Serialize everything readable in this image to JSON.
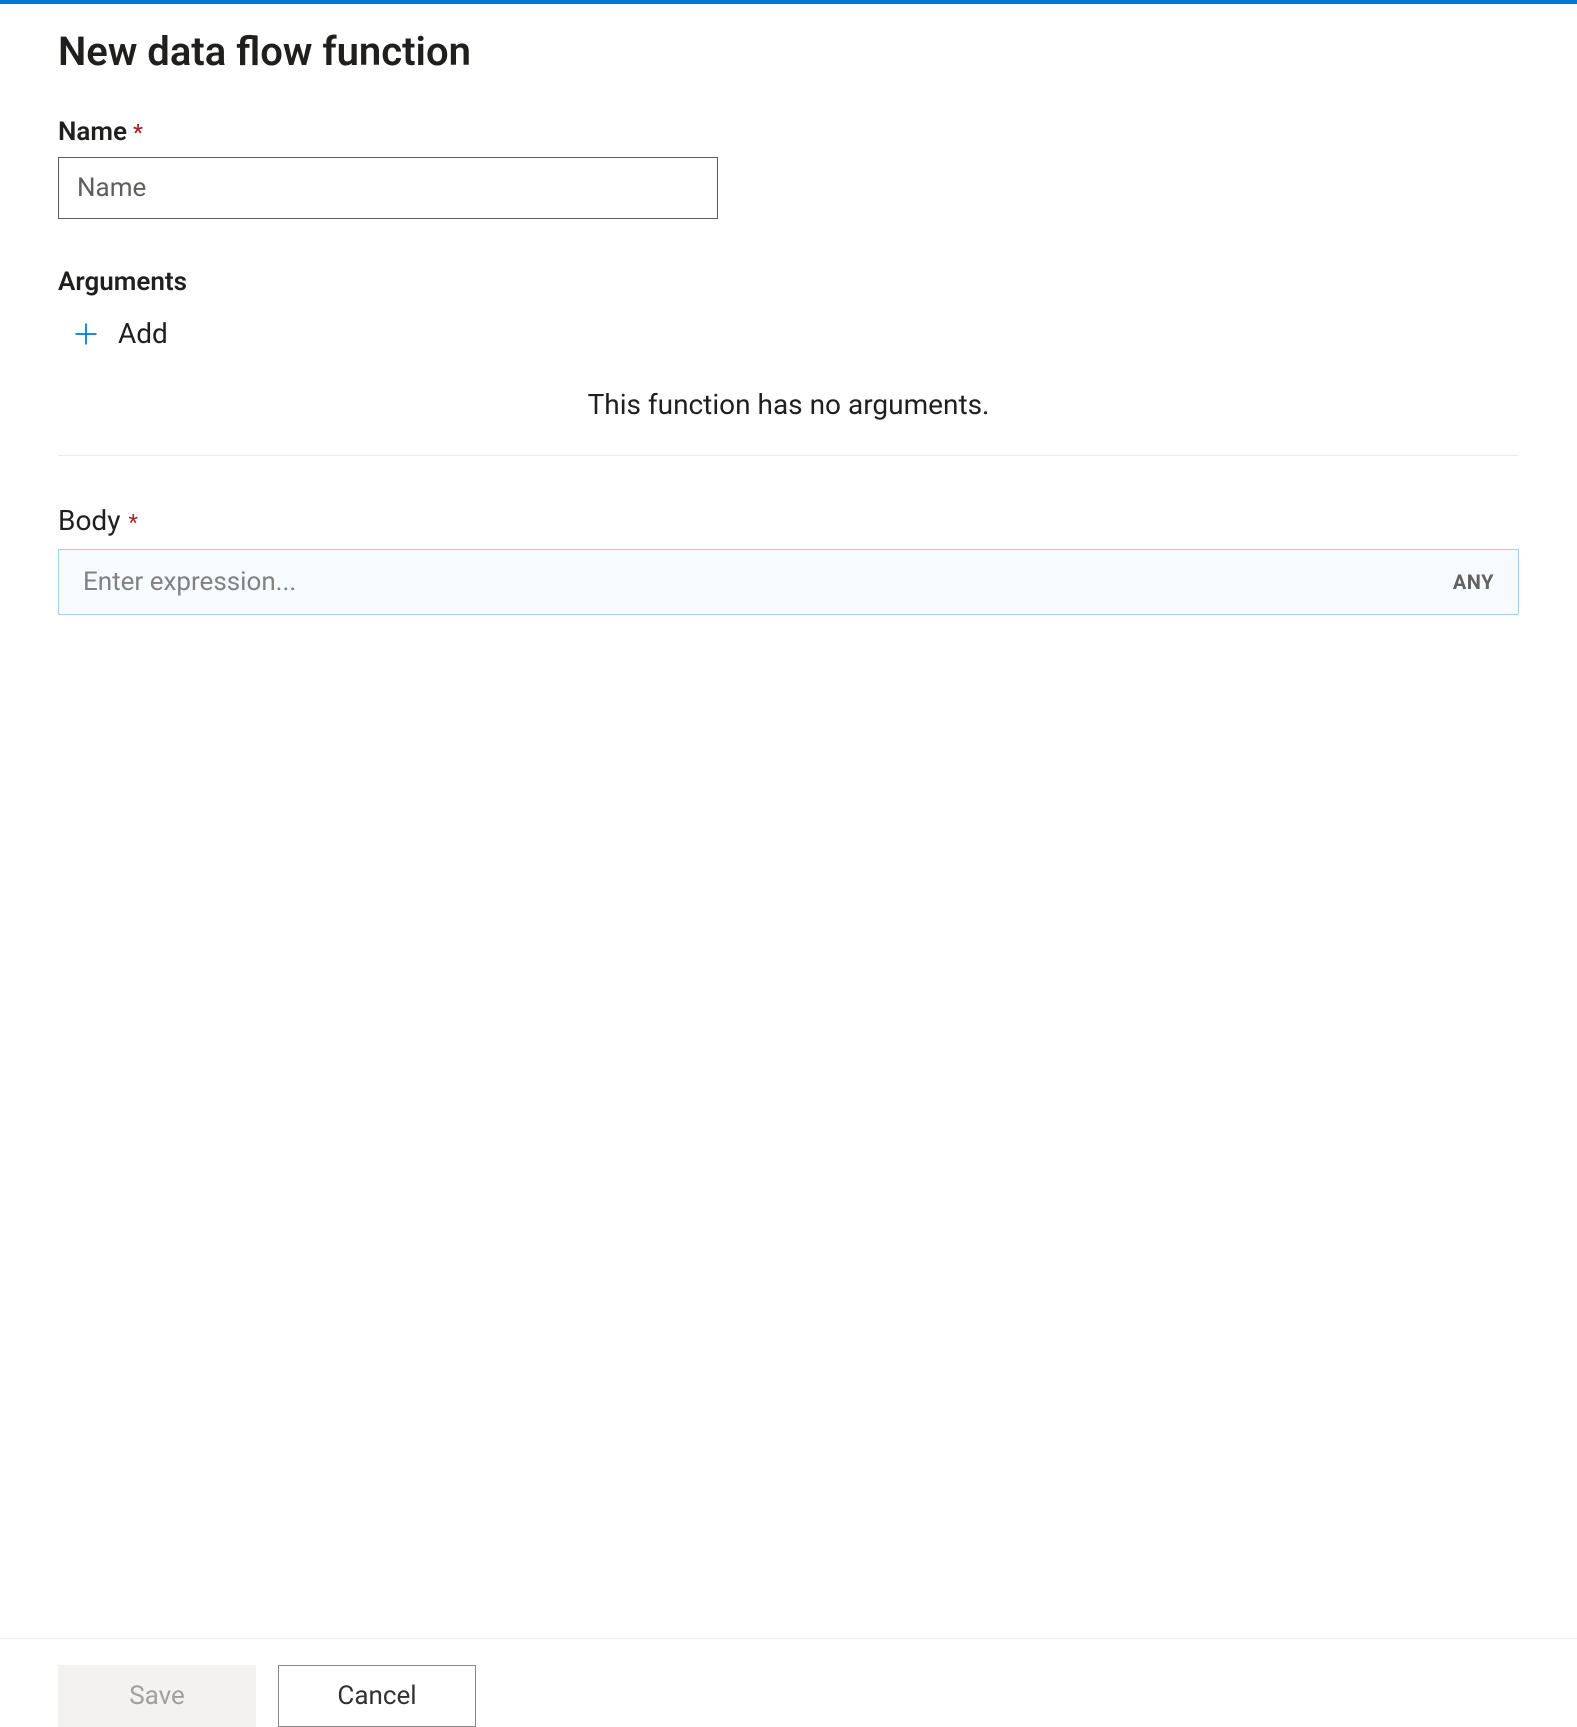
{
  "header": {
    "title": "New data flow function"
  },
  "name_field": {
    "label": "Name",
    "placeholder": "Name",
    "value": ""
  },
  "arguments": {
    "label": "Arguments",
    "add_label": "Add",
    "empty_message": "This function has no arguments."
  },
  "body_field": {
    "label": "Body",
    "placeholder": "Enter expression...",
    "value": "",
    "type_badge": "ANY"
  },
  "footer": {
    "save_label": "Save",
    "cancel_label": "Cancel"
  },
  "colors": {
    "accent": "#0078d4",
    "required": "#a4262c",
    "body_border": "#a6cfec",
    "body_bg": "#f6fbff"
  }
}
